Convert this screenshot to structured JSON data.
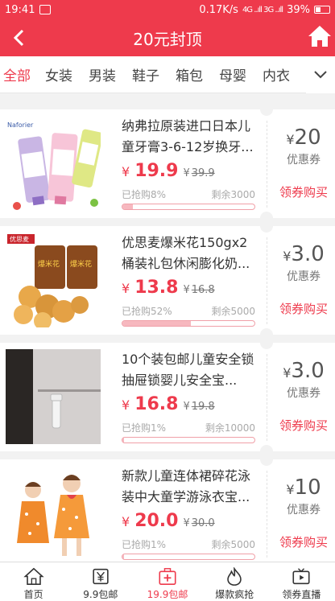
{
  "status_bar": {
    "time": "19:41",
    "speed": "0.17K/s",
    "signal": "4G ..ıll 3G ..ıll",
    "battery": "39%"
  },
  "header": {
    "title": "20元封顶"
  },
  "tabs": [
    "全部",
    "女装",
    "男装",
    "鞋子",
    "箱包",
    "母婴",
    "内衣"
  ],
  "products": [
    {
      "name": "纳弗拉原装进口日本儿童牙膏3-6-12岁换牙...",
      "yen": "¥",
      "price": "19.9",
      "orig_yen": "¥",
      "orig_price": "39.9",
      "sold": "已抢购8%",
      "remain": "剩余3000",
      "progress": 0.08,
      "coupon_yen": "¥",
      "coupon_value": "20",
      "coupon_label": "优惠券",
      "buy_label": "领券购买",
      "brand": "Naforier"
    },
    {
      "name": "优思麦爆米花150gx2桶装礼包休闲膨化奶...",
      "yen": "¥",
      "price": "13.8",
      "orig_yen": "¥",
      "orig_price": "16.8",
      "sold": "已抢购52%",
      "remain": "剩余5000",
      "progress": 0.52,
      "coupon_yen": "¥",
      "coupon_value": "3.0",
      "coupon_label": "优惠券",
      "buy_label": "领券购买",
      "brand": "优思麦",
      "jar_text": "爆米花"
    },
    {
      "name": "10个装包邮儿童安全锁抽屉锁婴儿安全宝...",
      "yen": "¥",
      "price": "16.8",
      "orig_yen": "¥",
      "orig_price": "19.8",
      "sold": "已抢购1%",
      "remain": "剩余10000",
      "progress": 0.01,
      "coupon_yen": "¥",
      "coupon_value": "3.0",
      "coupon_label": "优惠券",
      "buy_label": "领券购买"
    },
    {
      "name": "新款儿童连体裙碎花泳装中大童学游泳衣宝...",
      "yen": "¥",
      "price": "20.0",
      "orig_yen": "¥",
      "orig_price": "30.0",
      "sold": "已抢购1%",
      "remain": "剩余5000",
      "progress": 0.01,
      "coupon_yen": "¥",
      "coupon_value": "10",
      "coupon_label": "优惠券",
      "buy_label": "领券购买"
    }
  ],
  "bottom_nav": [
    {
      "label": "首页",
      "icon": "home-icon"
    },
    {
      "label": "9.9包邮",
      "icon": "yen-tag-icon"
    },
    {
      "label": "19.9包邮",
      "icon": "medical-box-icon"
    },
    {
      "label": "爆款疯抢",
      "icon": "flame-icon"
    },
    {
      "label": "领券直播",
      "icon": "tv-play-icon"
    }
  ],
  "colors": {
    "accent": "#ee3a4c",
    "background": "#f2f2f2",
    "progress_fill": "#f7b8bf"
  }
}
